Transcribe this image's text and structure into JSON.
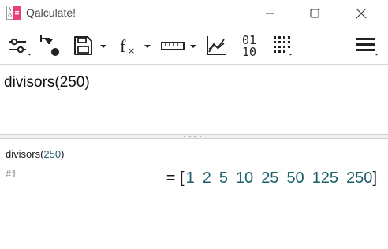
{
  "window": {
    "title": "Qalculate!",
    "controls": [
      "minimize",
      "maximize",
      "close"
    ]
  },
  "toolbar": {
    "buttons": [
      {
        "name": "mode-settings",
        "icon": "sliders-icon",
        "dropdown": true
      },
      {
        "name": "store-variable",
        "icon": "store-arrow-icon",
        "dropdown": false
      },
      {
        "name": "save",
        "icon": "floppy-disk-icon",
        "dropdown": true
      },
      {
        "name": "functions",
        "icon": "fx-icon",
        "dropdown": true
      },
      {
        "name": "units",
        "icon": "ruler-icon",
        "dropdown": true
      },
      {
        "name": "plot",
        "icon": "plot-chart-icon",
        "dropdown": false
      },
      {
        "name": "number-bases",
        "icon": "binary-icon",
        "label_top": "01",
        "label_bottom": "10",
        "dropdown": false
      },
      {
        "name": "keypad",
        "icon": "keypad-grid-icon",
        "dropdown": true
      },
      {
        "name": "menu",
        "icon": "hamburger-menu-icon",
        "dropdown": true
      }
    ],
    "fx_label": "f"
  },
  "expression": {
    "text": "divisors(250)"
  },
  "history": {
    "entry": {
      "expr_func": "divisors(",
      "expr_arg": "250",
      "expr_close": ")",
      "ref": "#1",
      "equals": "=",
      "open_bracket": "[",
      "close_bracket": "]",
      "values": [
        "1",
        "2",
        "5",
        "10",
        "25",
        "50",
        "125",
        "250"
      ]
    }
  },
  "colors": {
    "app_icon_pink": "#e8407a",
    "result_number": "#1c5f6b",
    "ref_gray": "#8a8a8a"
  }
}
